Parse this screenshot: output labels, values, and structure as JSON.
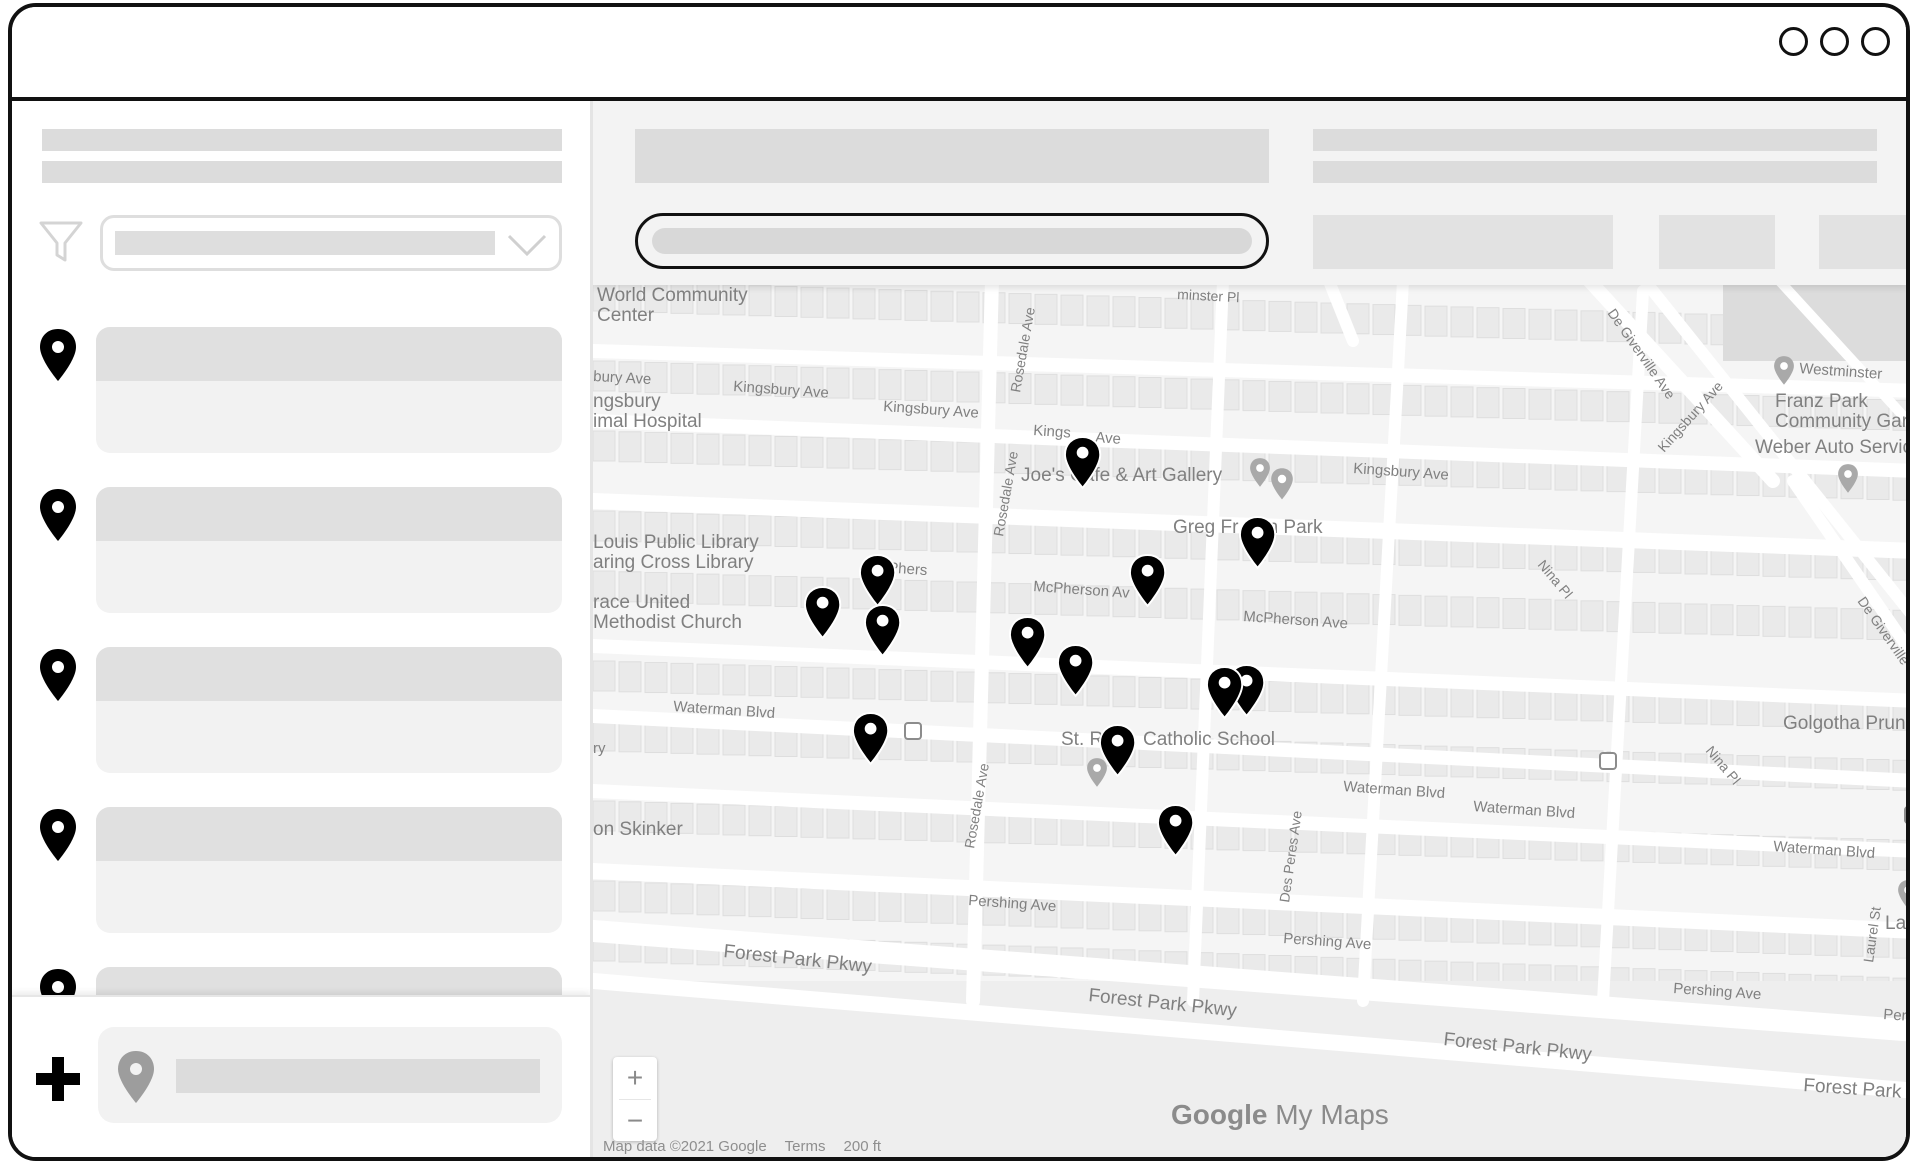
{
  "map": {
    "labels": [
      {
        "id": "label-world-community",
        "text": "World Community"
      },
      {
        "id": "label-center",
        "text": "Center"
      },
      {
        "id": "label-minster-pl",
        "text": "minster Pl"
      },
      {
        "id": "label-bury-ave",
        "text": "bury Ave"
      },
      {
        "id": "label-kingsbury-1",
        "text": "Kingsbury Ave"
      },
      {
        "id": "label-kingsbury-2",
        "text": "Kingsbury Ave"
      },
      {
        "id": "label-kingsbury-3",
        "text": "Kings"
      },
      {
        "id": "label-kingsbury-3b",
        "text": "Ave"
      },
      {
        "id": "label-kingsbury-4",
        "text": "Kingsbury Ave"
      },
      {
        "id": "label-ngsbury",
        "text": "ngsbury"
      },
      {
        "id": "label-animal-hospital",
        "text": "imal Hospital"
      },
      {
        "id": "label-joes-cafe",
        "text": "Joe's Cafe & Art Gallery"
      },
      {
        "id": "label-greg-park-1",
        "text": "Greg Fr"
      },
      {
        "id": "label-greg-park-2",
        "text": "an Park"
      },
      {
        "id": "label-library-1",
        "text": "Louis Public Library"
      },
      {
        "id": "label-library-2",
        "text": "aring Cross Library"
      },
      {
        "id": "label-church-1",
        "text": "race United"
      },
      {
        "id": "label-church-2",
        "text": "Methodist Church"
      },
      {
        "id": "label-mcpherson-1",
        "text": "McPhers"
      },
      {
        "id": "label-mcpherson-2",
        "text": "McPherson Av"
      },
      {
        "id": "label-mcpherson-3",
        "text": "McPherson Ave"
      },
      {
        "id": "label-waterman-1",
        "text": "Waterman Blvd"
      },
      {
        "id": "label-waterman-2",
        "text": "Waterman Blvd"
      },
      {
        "id": "label-waterman-3",
        "text": "Waterman Blvd"
      },
      {
        "id": "label-waterman-4",
        "text": "Waterman Blvd"
      },
      {
        "id": "label-ry",
        "text": "ry"
      },
      {
        "id": "label-school-1",
        "text": "St. R"
      },
      {
        "id": "label-school-2",
        "text": "Catholic School"
      },
      {
        "id": "label-skinker",
        "text": "on Skinker"
      },
      {
        "id": "label-pershing-1",
        "text": "Pershing Ave"
      },
      {
        "id": "label-pershing-2",
        "text": "Pershing Ave"
      },
      {
        "id": "label-pershing-3",
        "text": "Pershing Ave"
      },
      {
        "id": "label-pershing-4",
        "text": "Persh"
      },
      {
        "id": "label-forest-park-1",
        "text": "Forest Park Pkwy"
      },
      {
        "id": "label-forest-park-2",
        "text": "Forest Park Pkwy"
      },
      {
        "id": "label-forest-park-3",
        "text": "Forest Park Pkwy"
      },
      {
        "id": "label-forest-park-4",
        "text": "Forest Park P"
      },
      {
        "id": "label-rosedale-1",
        "text": "Rosedale Ave"
      },
      {
        "id": "label-rosedale-2",
        "text": "Rosedale Ave"
      },
      {
        "id": "label-rosedale-3",
        "text": "Rosedale Ave"
      },
      {
        "id": "label-des-peres",
        "text": "Des Peres Ave"
      },
      {
        "id": "label-de-giverville-1",
        "text": "De Giverville Ave"
      },
      {
        "id": "label-de-giverville-2",
        "text": "De Giverville"
      },
      {
        "id": "label-kingsbury-diag",
        "text": "Kingsbury Ave"
      },
      {
        "id": "label-nina-pl-1",
        "text": "Nina Pl"
      },
      {
        "id": "label-nina-pl-2",
        "text": "Nina Pl"
      },
      {
        "id": "label-westminster",
        "text": "Westminster"
      },
      {
        "id": "label-franz-park-1",
        "text": "Franz Park"
      },
      {
        "id": "label-franz-park-2",
        "text": "Community Gard"
      },
      {
        "id": "label-weber-auto",
        "text": "Weber Auto Service"
      },
      {
        "id": "label-golgotha",
        "text": "Golgotha Prune"
      },
      {
        "id": "label-laurel-st",
        "text": "Laurel St"
      },
      {
        "id": "label-laur",
        "text": "Laur"
      }
    ],
    "zoom_in": "+",
    "zoom_out": "−",
    "logo_google": "Google",
    "logo_my_maps": "My Maps",
    "attribution": {
      "data": "Map data ©2021 Google",
      "terms": "Terms",
      "scale": "200 ft"
    }
  },
  "colors": {
    "pin": "#000000",
    "placeholder": "#dcdcdc",
    "map_bg": "#f5f5f5",
    "road": "#ffffff",
    "block": "#e9e9e9"
  }
}
